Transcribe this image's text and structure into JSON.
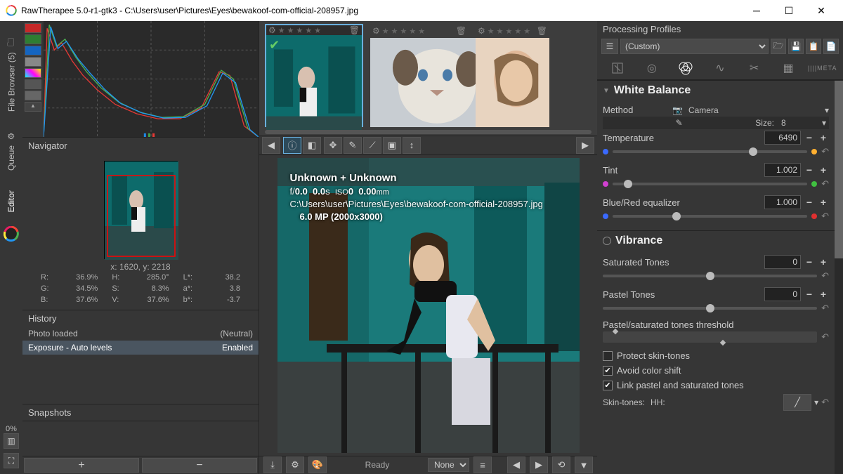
{
  "titlebar": {
    "title": "RawTherapee 5.0-r1-gtk3 - C:\\Users\\user\\Pictures\\Eyes\\bewakoof-com-official-208957.jpg"
  },
  "left_tabs": {
    "file_browser": "File Browser (5)",
    "queue": "Queue",
    "editor": "Editor"
  },
  "left_pct": "0%",
  "navigator": {
    "title": "Navigator",
    "coords": "x: 1620, y: 2218",
    "R": "R:",
    "Rv": "36.9%",
    "G": "G:",
    "Gv": "34.5%",
    "B": "B:",
    "Bv": "37.6%",
    "H": "H:",
    "Hv": "285.0°",
    "S": "S:",
    "Sv": "8.3%",
    "V": "V:",
    "Vv": "37.6%",
    "L": "L*:",
    "Lv": "38.2",
    "a": "a*:",
    "av": "3.8",
    "b": "b*:",
    "bv": "-3.7"
  },
  "history": {
    "title": "History",
    "rows": [
      {
        "name": "Photo loaded",
        "state": "(Neutral)"
      },
      {
        "name": "Exposure - Auto levels",
        "state": "Enabled"
      }
    ]
  },
  "snapshots": {
    "title": "Snapshots"
  },
  "preview_overlay": {
    "l1": "Unknown + Unknown",
    "l2_f": "f/",
    "l2_fv": "0.0",
    "l2_t": "0.0",
    "l2_ts": "s",
    "l2_iso": "ISO",
    "l2_isov": "0",
    "l2_mm": "0.00",
    "l2_mmu": "mm",
    "l3": "C:\\Users\\user\\Pictures\\Eyes\\bewakoof-com-official-208957.jpg",
    "l4": "6.0 MP (2000x3000)"
  },
  "bottom_bar": {
    "ready": "Ready",
    "none": "None"
  },
  "processing_profiles": {
    "title": "Processing Profiles",
    "current": "(Custom)"
  },
  "tabs": {
    "meta": "META"
  },
  "white_balance": {
    "title": "White Balance",
    "method_lbl": "Method",
    "method_val": "Camera",
    "size_lbl": "Size:",
    "size_val": "8",
    "temp_lbl": "Temperature",
    "temp_val": "6490",
    "tint_lbl": "Tint",
    "tint_val": "1.002",
    "br_lbl": "Blue/Red equalizer",
    "br_val": "1.000"
  },
  "vibrance": {
    "title": "Vibrance",
    "sat_lbl": "Saturated Tones",
    "sat_val": "0",
    "pastel_lbl": "Pastel Tones",
    "pastel_val": "0",
    "thresh_lbl": "Pastel/saturated tones threshold",
    "cb1": "Protect skin-tones",
    "cb2": "Avoid color shift",
    "cb3": "Link pastel and saturated tones",
    "skin_lbl": "Skin-tones:",
    "skin_curve": "HH:"
  }
}
